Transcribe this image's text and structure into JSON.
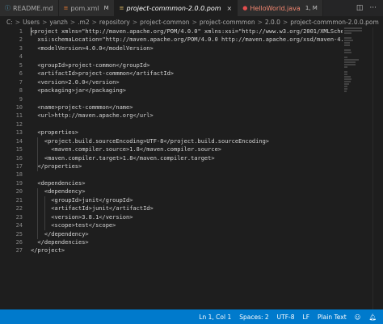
{
  "tabs": [
    {
      "label": "README.md",
      "icon": "info-icon",
      "modified": false,
      "active": false
    },
    {
      "label": "pom.xml",
      "icon": "xml-icon",
      "modified": true,
      "modified_label": "M",
      "active": false
    },
    {
      "label": "project-commmon-2.0.0.pom",
      "icon": "xml-icon",
      "modified": false,
      "active": true
    },
    {
      "label": "HelloWorld.java",
      "icon": "java-icon",
      "modified": true,
      "modified_label": "1, M",
      "active": false
    }
  ],
  "tab_actions": {
    "split": "◫",
    "more": "···",
    "close": "×"
  },
  "breadcrumb": [
    "C:",
    "Users",
    "yanzh",
    ".m2",
    "repository",
    "project-common",
    "project-commmon",
    "2.0.0",
    "project-commmon-2.0.0.pom"
  ],
  "breadcrumb_sep": ">",
  "editor": {
    "lines": [
      "<project xmlns=\"http://maven.apache.org/POM/4.0.0\" xmlns:xsi=\"http://www.w3.org/2001/XMLSche",
      "  xsi:schemaLocation=\"http://maven.apache.org/POM/4.0.0 http://maven.apache.org/xsd/maven-4.",
      "  <modelVersion>4.0.0</modelVersion>",
      "",
      "  <groupId>project-common</groupId>",
      "  <artifactId>project-commmon</artifactId>",
      "  <version>2.0.0</version>",
      "  <packaging>jar</packaging>",
      "",
      "  <name>project-commmon</name>",
      "  <url>http://maven.apache.org</url>",
      "",
      "  <properties>",
      "    <project.build.sourceEncoding>UTF-8</project.build.sourceEncoding>",
      "      <maven.compiler.source>1.8</maven.compiler.source>",
      "    <maven.compiler.target>1.8</maven.compiler.target>",
      "  </properties>",
      "",
      "  <dependencies>",
      "    <dependency>",
      "      <groupId>junit</groupId>",
      "      <artifactId>junit</artifactId>",
      "      <version>3.8.1</version>",
      "      <scope>test</scope>",
      "    </dependency>",
      "  </dependencies>",
      "</project>"
    ]
  },
  "status": {
    "left_icon": "bell-icon",
    "position": "Ln 1, Col 1",
    "spaces": "Spaces: 2",
    "encoding": "UTF-8",
    "eol": "LF",
    "language": "Plain Text",
    "feedback_icon": "feedback-icon",
    "bell_icon": "bell-icon"
  },
  "colors": {
    "statusbar": "#007acc",
    "editor_bg": "#1e1e1e",
    "tab_bg": "#2d2d2d"
  }
}
